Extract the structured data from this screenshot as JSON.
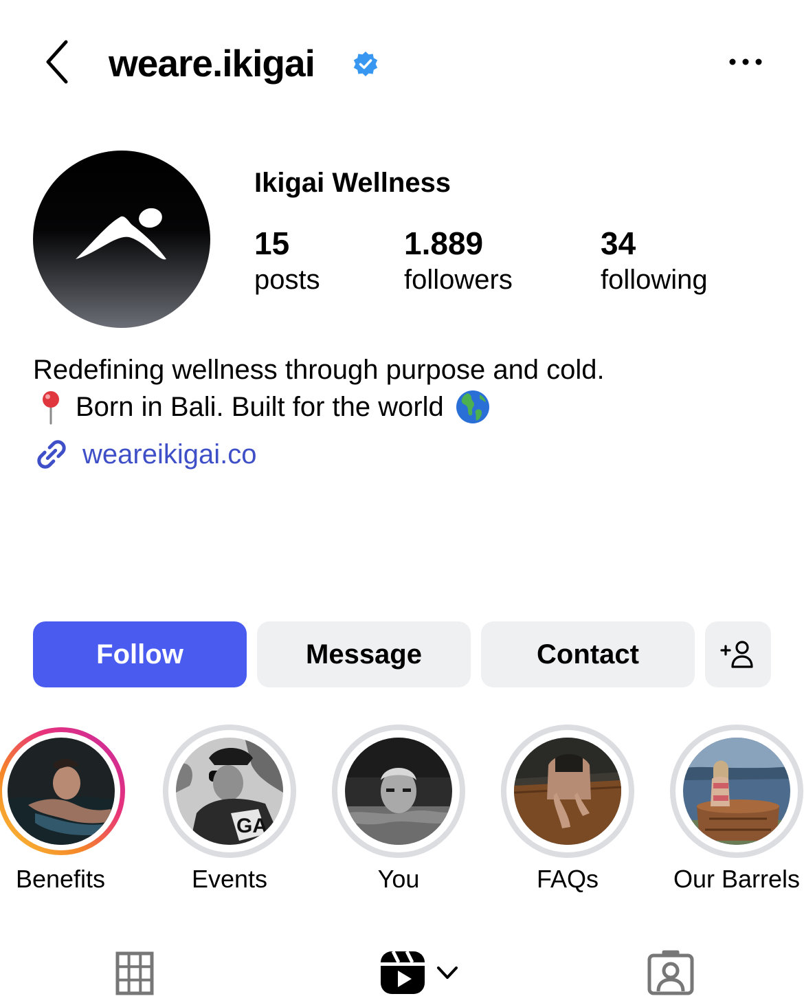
{
  "header": {
    "username": "weare.ikigai",
    "icons": {
      "back": "chevron-left-icon",
      "verified": "verified-badge-icon",
      "more": "more-horizontal-icon"
    }
  },
  "profile": {
    "display_name": "Ikigai Wellness",
    "stats": [
      {
        "value": "15",
        "label": "posts"
      },
      {
        "value": "1.889",
        "label": "followers"
      },
      {
        "value": "34",
        "label": "following"
      }
    ],
    "bio_line1": "Redefining wellness through purpose and cold.",
    "bio_line2": "Born in Bali. Built for the world",
    "bio_icons": [
      "pin-icon",
      "globe-icon"
    ],
    "link": "weareikigai.co"
  },
  "buttons": {
    "follow": "Follow",
    "message": "Message",
    "contact": "Contact",
    "add_person_icon": "add-person-icon"
  },
  "highlights": [
    {
      "label": "Benefits"
    },
    {
      "label": "Events"
    },
    {
      "label": "You"
    },
    {
      "label": "FAQs"
    },
    {
      "label": "Our Barrels"
    }
  ],
  "tabs": [
    "grid-icon",
    "reels-icon",
    "tagged-icon"
  ],
  "colors": {
    "accent": "#4a5cf0",
    "link": "#3f4fc7",
    "verified": "#3897f0",
    "button_bg": "#eff0f2"
  }
}
